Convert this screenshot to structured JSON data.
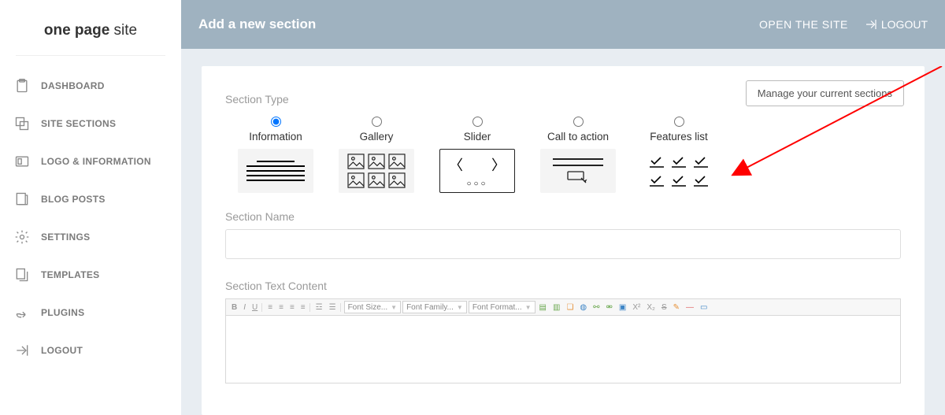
{
  "brand": {
    "bold": "one page",
    "light": " site"
  },
  "sidebar": {
    "items": [
      {
        "label": "DASHBOARD"
      },
      {
        "label": "SITE SECTIONS"
      },
      {
        "label": "LOGO & INFORMATION"
      },
      {
        "label": "BLOG POSTS"
      },
      {
        "label": "SETTINGS"
      },
      {
        "label": "TEMPLATES"
      },
      {
        "label": "PLUGINS"
      },
      {
        "label": "LOGOUT"
      }
    ]
  },
  "topbar": {
    "title": "Add a new section",
    "open_site": "OPEN THE SITE",
    "logout": "LOGOUT"
  },
  "card": {
    "manage_btn": "Manage your current sections",
    "section_type_label": "Section Type",
    "section_name_label": "Section Name",
    "section_name_value": "",
    "section_text_label": "Section Text Content",
    "types": [
      {
        "name": "Information",
        "selected": true
      },
      {
        "name": "Gallery",
        "selected": false
      },
      {
        "name": "Slider",
        "selected": false
      },
      {
        "name": "Call to action",
        "selected": false
      },
      {
        "name": "Features list",
        "selected": false
      }
    ],
    "editor": {
      "font_size": "Font Size...",
      "font_family": "Font Family...",
      "font_format": "Font Format..."
    }
  }
}
